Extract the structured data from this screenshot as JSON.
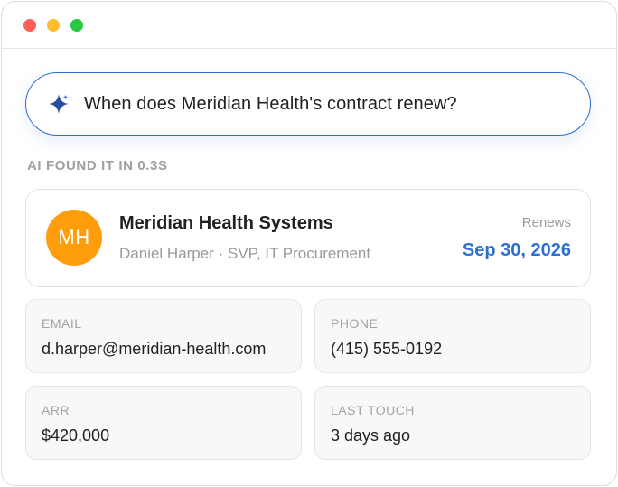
{
  "search": {
    "icon": "sparkle-icon",
    "query": "When does Meridian Health's contract renew?",
    "accent_color": "#2f6fd0"
  },
  "result": {
    "status": "AI FOUND IT IN 0.3S",
    "avatar_initials": "MH",
    "avatar_color": "#ff9d0a",
    "company": "Meridian Health Systems",
    "contact": "Daniel Harper · SVP, IT Procurement",
    "renews_label": "Renews",
    "renews_date": "Sep 30, 2026"
  },
  "fields": {
    "email": {
      "label": "EMAIL",
      "value": "d.harper@meridian-health.com"
    },
    "phone": {
      "label": "PHONE",
      "value": "(415) 555-0192"
    },
    "arr": {
      "label": "ARR",
      "value": "$420,000"
    },
    "last_touch": {
      "label": "LAST TOUCH",
      "value": "3 days ago"
    }
  },
  "window_controls": {
    "close_color": "#ff5f57",
    "minimize_color": "#febc2e",
    "zoom_color": "#28c840"
  }
}
